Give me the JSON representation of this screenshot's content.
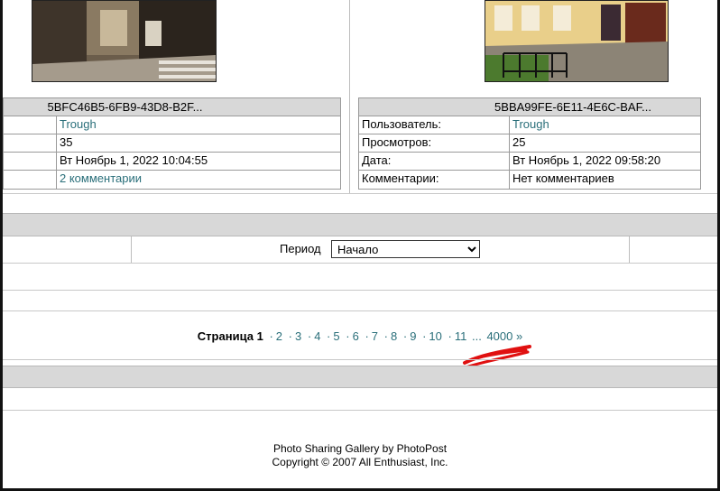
{
  "left_photo": {
    "title": "5BFC46B5-6FB9-43D8-B2F...",
    "user": "Trough",
    "views": "35",
    "date": "Вт Ноябрь 1, 2022 10:04:55",
    "comments": "2 комментарии"
  },
  "right_photo": {
    "title": "5BBA99FE-6E11-4E6C-BAF...",
    "user_label": "Пользователь:",
    "user": "Trough",
    "views_label": "Просмотров:",
    "views": "25",
    "date_label": "Дата:",
    "date": "Вт Ноябрь 1, 2022 09:58:20",
    "comments_label": "Комментарии:",
    "comments": "Нет комментариев"
  },
  "period": {
    "label": "Период",
    "selected": "Начало"
  },
  "pagination": {
    "label": "Страница",
    "current": "1",
    "pages": [
      "2",
      "3",
      "4",
      "5",
      "6",
      "7",
      "8",
      "9",
      "10",
      "11"
    ],
    "ellipsis": "...",
    "last": "4000 »"
  },
  "footer": {
    "line1": "Photo Sharing Gallery by PhotoPost",
    "line2": "Copyright © 2007 All Enthusiast, Inc."
  },
  "colors": {
    "link": "#2a6f7a",
    "header_gray": "#d8d8d8",
    "annotation_red": "#e01010"
  }
}
